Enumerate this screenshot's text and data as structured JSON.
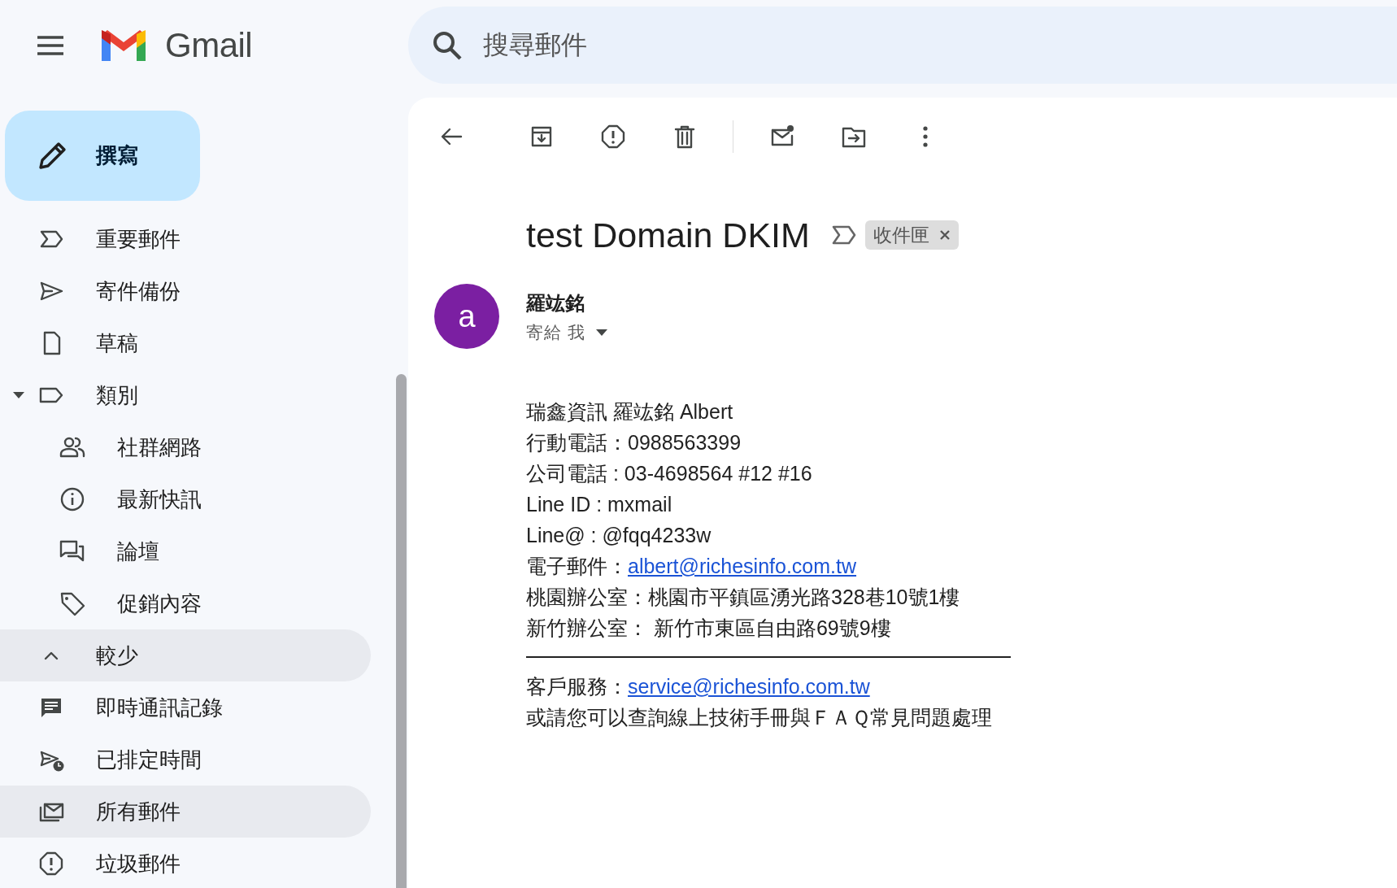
{
  "header": {
    "product_name": "Gmail",
    "search": {
      "placeholder": "搜尋郵件"
    }
  },
  "compose": {
    "label": "撰寫"
  },
  "sidebar": {
    "items": [
      {
        "label": "重要郵件",
        "highlighted": false
      },
      {
        "label": "寄件備份",
        "highlighted": false
      },
      {
        "label": "草稿",
        "highlighted": false
      },
      {
        "label": "類別",
        "highlighted": false,
        "expanded": true,
        "children": [
          {
            "label": "社群網路",
            "highlighted": false
          },
          {
            "label": "最新快訊",
            "highlighted": false
          },
          {
            "label": "論壇",
            "highlighted": false
          },
          {
            "label": "促銷內容",
            "highlighted": false
          }
        ]
      },
      {
        "label": "較少",
        "highlighted": true
      },
      {
        "label": "即時通訊記錄",
        "highlighted": false
      },
      {
        "label": "已排定時間",
        "highlighted": false
      },
      {
        "label": "所有郵件",
        "highlighted": true
      },
      {
        "label": "垃圾郵件",
        "highlighted": false
      }
    ]
  },
  "message": {
    "subject": "test Domain DKIM",
    "important": false,
    "labels": [
      {
        "label": "收件匣",
        "removable": true
      }
    ],
    "sender": {
      "avatar_letter": "a",
      "name": "羅竑銘",
      "recipient": "寄給 我"
    },
    "body": [
      {
        "kind": "text",
        "text": "瑞鑫資訊 羅竑銘 Albert"
      },
      {
        "kind": "text",
        "text": "行動電話：0988563399"
      },
      {
        "kind": "text",
        "text": "公司電話 : 03-4698564 #12 #16"
      },
      {
        "kind": "text",
        "text": "Line ID : mxmail"
      },
      {
        "kind": "text",
        "text": "Line@ : @fqq4233w"
      },
      {
        "kind": "link",
        "text": "電子郵件：",
        "link": "albert@richesinfo.com.tw"
      },
      {
        "kind": "text",
        "text": "桃園辦公室：桃園市平鎮區湧光路328巷10號1樓"
      },
      {
        "kind": "text",
        "text": "新竹辦公室： 新竹市東區自由路69號9樓"
      },
      {
        "kind": "rule"
      },
      {
        "kind": "link",
        "text": "客戶服務：",
        "link": "service@richesinfo.com.tw"
      },
      {
        "kind": "text",
        "text": "或請您可以查詢線上技術手冊與ＦＡＱ常見問題處理"
      }
    ]
  }
}
